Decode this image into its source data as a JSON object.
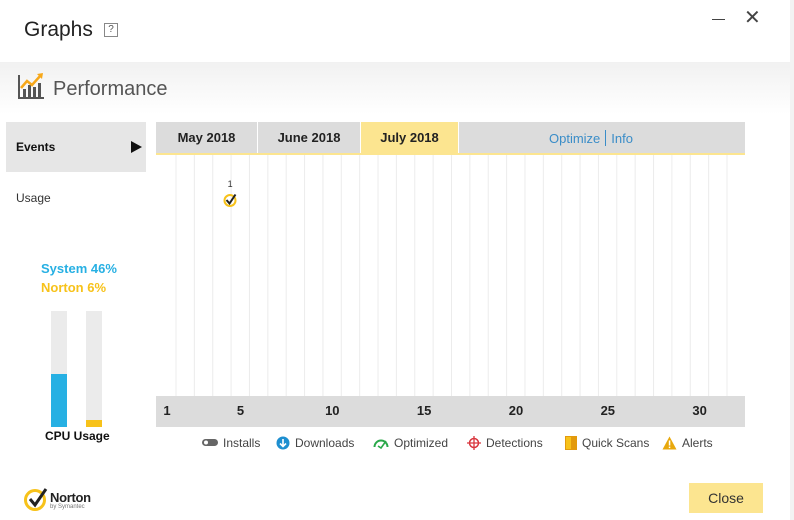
{
  "window": {
    "title": "Graphs",
    "help_label": "?",
    "minimize_icon": "minimize-icon",
    "close_icon": "close-icon",
    "close_glyph": "✕"
  },
  "section": {
    "title": "Performance",
    "icon": "performance-chart-icon"
  },
  "nav": {
    "items": [
      {
        "label": "Events",
        "selected": true
      },
      {
        "label": "Usage",
        "selected": false
      }
    ]
  },
  "cpu": {
    "system_label": "System 46%",
    "norton_label": "Norton 6%",
    "system_percent": 46,
    "norton_percent": 6,
    "label": "CPU Usage",
    "system_color": "#27b0e3",
    "norton_color": "#f7c21a"
  },
  "tabs": [
    {
      "label": "May 2018",
      "active": false
    },
    {
      "label": "June 2018",
      "active": false
    },
    {
      "label": "July 2018",
      "active": true
    }
  ],
  "links": {
    "optimize": "Optimize",
    "info": "Info"
  },
  "calendar": {
    "days_in_month": 31,
    "axis_ticks": [
      "1",
      "5",
      "10",
      "15",
      "20",
      "25",
      "30"
    ],
    "events": [
      {
        "day": 4,
        "count": "1",
        "type": "optimized"
      }
    ]
  },
  "legend": [
    {
      "label": "Installs",
      "icon": "installs-icon",
      "color": "#666666"
    },
    {
      "label": "Downloads",
      "icon": "downloads-icon",
      "color": "#1e8fd0"
    },
    {
      "label": "Optimized",
      "icon": "optimized-icon",
      "color": "#2aa84a"
    },
    {
      "label": "Detections",
      "icon": "detections-icon",
      "color": "#d9363e"
    },
    {
      "label": "Quick Scans",
      "icon": "quick-scans-icon",
      "color": "#f7a81a"
    },
    {
      "label": "Alerts",
      "icon": "alerts-icon",
      "color": "#e8a80c"
    }
  ],
  "brand": {
    "name": "Norton",
    "sub": "by Symantec",
    "accent": "#fce590"
  },
  "footer": {
    "close_label": "Close"
  }
}
